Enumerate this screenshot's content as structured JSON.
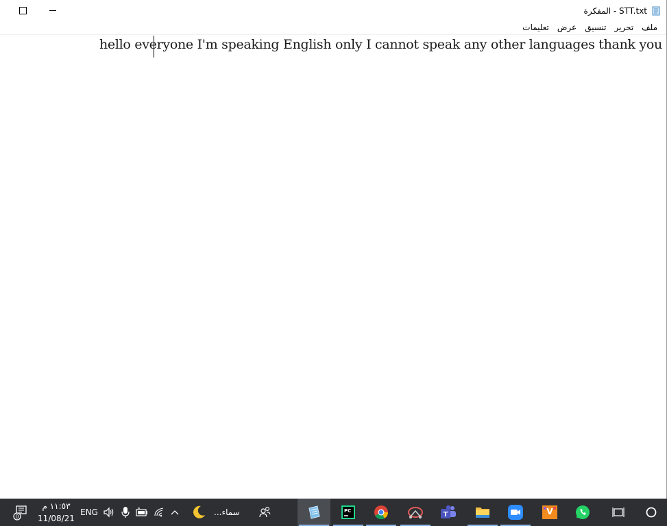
{
  "window": {
    "title": "STT.txt - المفكرة"
  },
  "menu": {
    "items": [
      "ملف",
      "تحرير",
      "تنسيق",
      "عرض",
      "تعليمات"
    ]
  },
  "editor": {
    "text": "hello everyone I'm speaking English only I cannot speak any other languages thank you"
  },
  "taskbar": {
    "clock_time": "١١:٥٣ م",
    "clock_date": "11/08/21",
    "language": "ENG",
    "weather_label": "سماء...",
    "notification_badge": "0",
    "apps": [
      {
        "name": "notepad-app",
        "icon": "notepad-icon",
        "active": true
      },
      {
        "name": "pycharm-app",
        "icon": "pycharm-icon",
        "active": false
      },
      {
        "name": "chrome-app",
        "icon": "chrome-icon",
        "active": false
      },
      {
        "name": "snipping-app",
        "icon": "snipping-icon",
        "active": false
      },
      {
        "name": "teams-app",
        "icon": "teams-icon",
        "active": false
      },
      {
        "name": "file-explorer-app",
        "icon": "folder-icon",
        "active": false
      },
      {
        "name": "zoom-app",
        "icon": "zoom-icon",
        "active": false
      },
      {
        "name": "vlc-app",
        "icon": "v-app-icon",
        "active": false
      },
      {
        "name": "whatsapp-app",
        "icon": "whatsapp-icon",
        "active": false
      }
    ]
  },
  "colors": {
    "taskbar_bg": "#2d2f33",
    "active_app_bg": "#4a4d52",
    "accent": "#8ab4e6"
  }
}
